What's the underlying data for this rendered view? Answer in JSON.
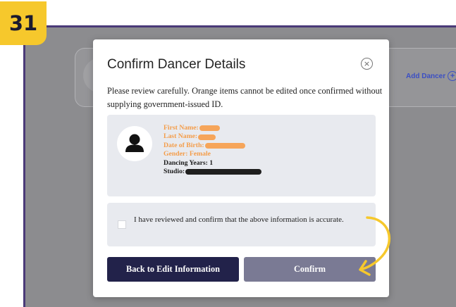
{
  "step": {
    "number": "31"
  },
  "background": {
    "add_dancer_label": "Add Dancer",
    "plus": "+"
  },
  "modal": {
    "title": "Confirm Dancer Details",
    "close": "×",
    "description": "Please review carefully. Orange items cannot be edited once confirmed without supplying government-issued ID.",
    "details": {
      "first_name_label": "First Name:",
      "last_name_label": "Last Name:",
      "dob_label": "Date of Birth:",
      "gender": "Gender: Female",
      "dancing_years": "Dancing Years: 1",
      "studio_label": "Studio:"
    },
    "confirm_text": "I have reviewed and confirm that the above information is accurate.",
    "back_button": "Back to Edit Information",
    "confirm_button": "Confirm"
  },
  "colors": {
    "badge": "#f6c82c",
    "frame_border": "#4a3a78",
    "orange_text": "#f49d4a",
    "back_button": "#22224a",
    "confirm_button": "#7a7a94",
    "annotation_arrow": "#f6c82c"
  }
}
